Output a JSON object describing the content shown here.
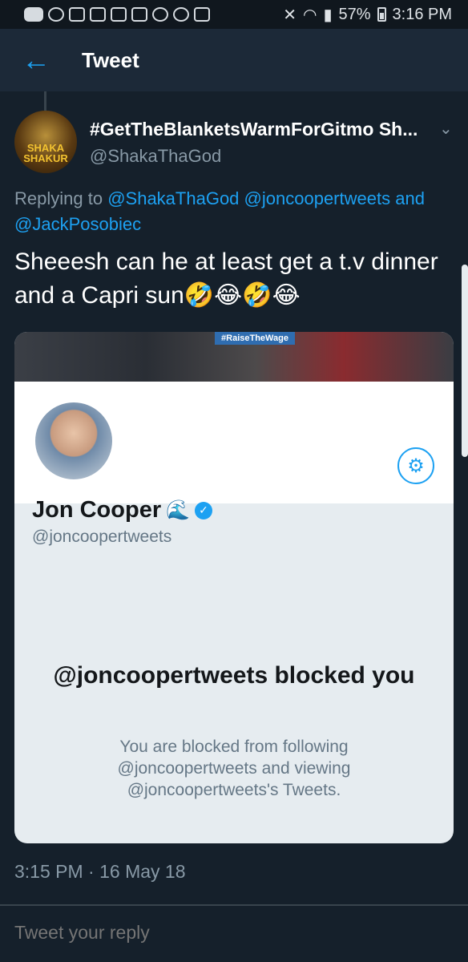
{
  "status_bar": {
    "battery": "57%",
    "time": "3:16 PM"
  },
  "header": {
    "title": "Tweet"
  },
  "tweet": {
    "display_name": "#GetTheBlanketsWarmForGitmo Sh...",
    "username": "@ShakaThaGod",
    "avatar_text": "SHAKA SHAKUR",
    "replying_prefix": "Replying to",
    "replying_mention_1": "@ShakaThaGod",
    "replying_mention_2": "@joncoopertweets",
    "replying_and": "and",
    "replying_mention_3": "@JackPosobiec",
    "text": "Sheeesh can he at least get a t.v dinner and a Capri sun🤣😂🤣😂",
    "timestamp": "3:15 PM · 16 May 18"
  },
  "card": {
    "banner_tag": "#RaiseTheWage",
    "name": "Jon Cooper",
    "name_emoji": "🌊",
    "handle": "@joncoopertweets",
    "blocked_title": "@joncoopertweets blocked you",
    "blocked_desc": "You are blocked from following @joncoopertweets and viewing @joncoopertweets's Tweets."
  },
  "reply": {
    "placeholder": "Tweet your reply"
  },
  "colors": {
    "background": "#15202b",
    "accent": "#1da1f2",
    "secondary_text": "#8899a6"
  },
  "icons": [
    "back-arrow-icon",
    "chevron-down-icon",
    "gear-icon",
    "verified-icon",
    "wave-icon"
  ]
}
